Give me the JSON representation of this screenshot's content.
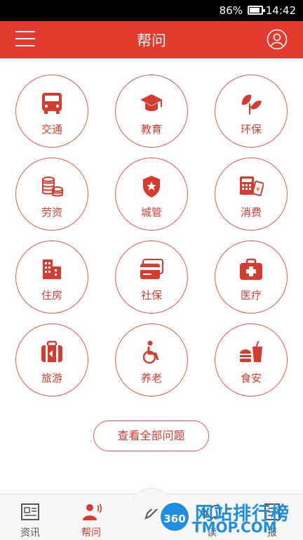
{
  "status_bar": {
    "battery": "86%",
    "time": "14:42"
  },
  "header": {
    "title": "帮问"
  },
  "categories": [
    {
      "label": "交通",
      "icon": "bus-icon"
    },
    {
      "label": "教育",
      "icon": "graduation-cap-icon"
    },
    {
      "label": "环保",
      "icon": "leaves-icon"
    },
    {
      "label": "劳资",
      "icon": "coins-icon"
    },
    {
      "label": "城管",
      "icon": "badge-icon"
    },
    {
      "label": "消费",
      "icon": "cash-register-icon"
    },
    {
      "label": "住房",
      "icon": "building-icon"
    },
    {
      "label": "社保",
      "icon": "card-icon"
    },
    {
      "label": "医疗",
      "icon": "medical-kit-icon"
    },
    {
      "label": "旅游",
      "icon": "luggage-icon"
    },
    {
      "label": "养老",
      "icon": "wheelchair-icon"
    },
    {
      "label": "食安",
      "icon": "burger-drink-icon"
    }
  ],
  "all_questions_button": "查看全部问题",
  "tabs": [
    {
      "label": "资讯",
      "icon": "news-icon",
      "active": false
    },
    {
      "label": "帮问",
      "icon": "consult-icon",
      "active": true
    },
    {
      "label": "",
      "icon": "pencil-icon",
      "active": false
    },
    {
      "label": "读",
      "icon": "read-icon",
      "active": false
    },
    {
      "label": "报",
      "icon": "report-icon",
      "active": false
    }
  ],
  "watermark": {
    "logo": "360",
    "cn": "网站排行榜",
    "en": "TMOP.COM"
  },
  "colors": {
    "brand_red": "#e23a2e",
    "watermark_blue": "#1e8fe0"
  }
}
